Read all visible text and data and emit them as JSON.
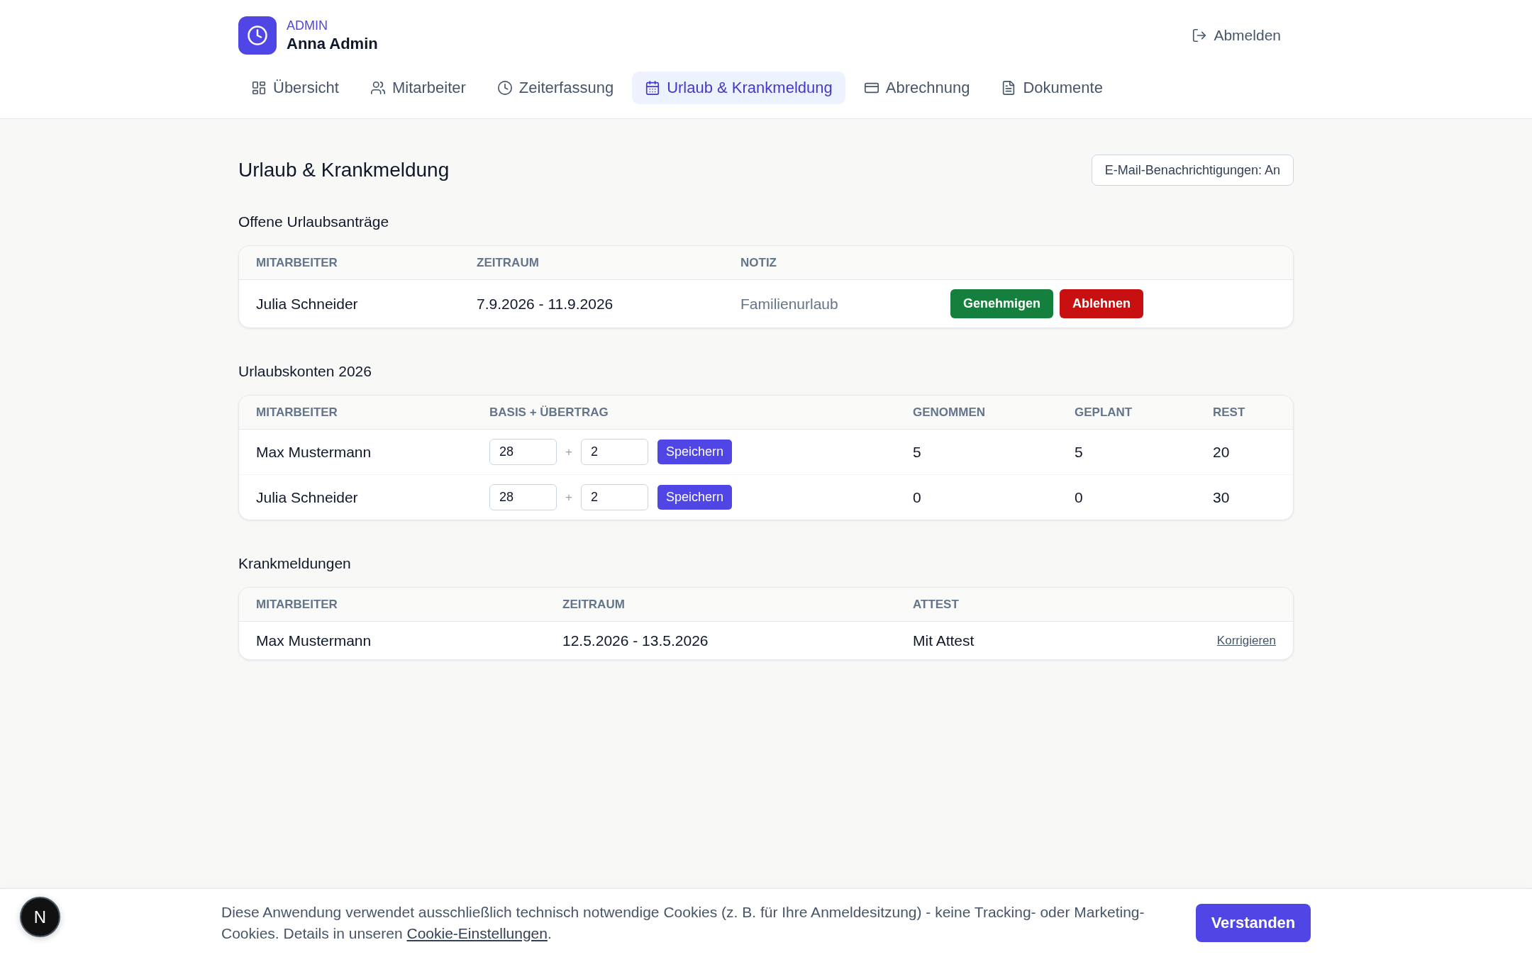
{
  "header": {
    "role": "ADMIN",
    "user": "Anna Admin",
    "logout": "Abmelden"
  },
  "nav": [
    {
      "label": "Übersicht",
      "selected": false
    },
    {
      "label": "Mitarbeiter",
      "selected": false
    },
    {
      "label": "Zeiterfassung",
      "selected": false
    },
    {
      "label": "Urlaub & Krankmeldung",
      "selected": true
    },
    {
      "label": "Abrechnung",
      "selected": false
    },
    {
      "label": "Dokumente",
      "selected": false
    }
  ],
  "page": {
    "title": "Urlaub & Krankmeldung",
    "notifications_button": "E-Mail-Benachrichtigungen: An"
  },
  "requests": {
    "title": "Offene Urlaubsanträge",
    "columns": [
      "MITARBEITER",
      "ZEITRAUM",
      "NOTIZ"
    ],
    "rows": [
      {
        "employee": "Julia Schneider",
        "period": "7.9.2026 - 11.9.2026",
        "note": "Familienurlaub",
        "approve": "Genehmigen",
        "reject": "Ablehnen"
      }
    ]
  },
  "accounts": {
    "title": "Urlaubskonten 2026",
    "columns": [
      "MITARBEITER",
      "BASIS + ÜBERTRAG",
      "GENOMMEN",
      "GEPLANT",
      "REST"
    ],
    "rows": [
      {
        "employee": "Max Mustermann",
        "base": "28",
        "plus": "+",
        "carryover": "2",
        "save": "Speichern",
        "taken": "5",
        "planned": "5",
        "rest": "20"
      },
      {
        "employee": "Julia Schneider",
        "base": "28",
        "plus": "+",
        "carryover": "2",
        "save": "Speichern",
        "taken": "0",
        "planned": "0",
        "rest": "30"
      }
    ]
  },
  "sick_notes": {
    "title": "Krankmeldungen",
    "columns": [
      "MITARBEITER",
      "ZEITRAUM",
      "ATTEST"
    ],
    "rows": [
      {
        "employee": "Max Mustermann",
        "period": "12.5.2026 - 13.5.2026",
        "certificate": "Mit Attest",
        "action": "Korrigieren"
      }
    ]
  },
  "cookie_banner": {
    "text": "Diese Anwendung verwendet ausschließlich technisch notwendige Cookies (z. B. für Ihre Anmeldesitzung) - keine Tracking- oder Marketing-Cookies. Details in unseren",
    "link": "Cookie-Einstellungen",
    "link_suffix": ".",
    "button": "Verstanden"
  },
  "dev_badge": {
    "label": "N"
  }
}
